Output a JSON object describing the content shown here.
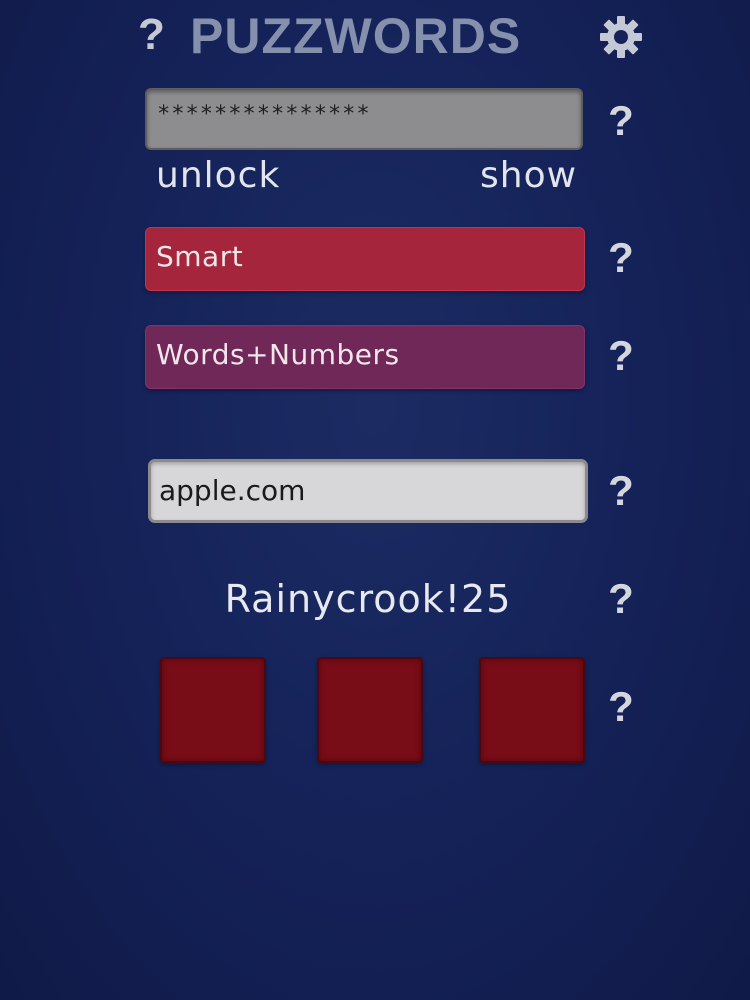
{
  "header": {
    "title": "PUZZWORDS",
    "help_label": "?",
    "settings_icon": "gear-icon"
  },
  "master_password": {
    "masked_value": "***************",
    "unlock_label": "unlock",
    "show_label": "show",
    "help_label": "?"
  },
  "options": {
    "strength": {
      "label": "Smart",
      "color": "#a5263c",
      "help_label": "?"
    },
    "style": {
      "label": "Words+Numbers",
      "color": "#6f2858",
      "help_label": "?"
    }
  },
  "site": {
    "value": "apple.com",
    "help_label": "?"
  },
  "result": {
    "password": "Rainycrook!25",
    "help_label": "?"
  },
  "squares": {
    "color": "#780c17",
    "help_label": "?"
  },
  "colors": {
    "background": "#15235a",
    "title": "#8590ad"
  }
}
